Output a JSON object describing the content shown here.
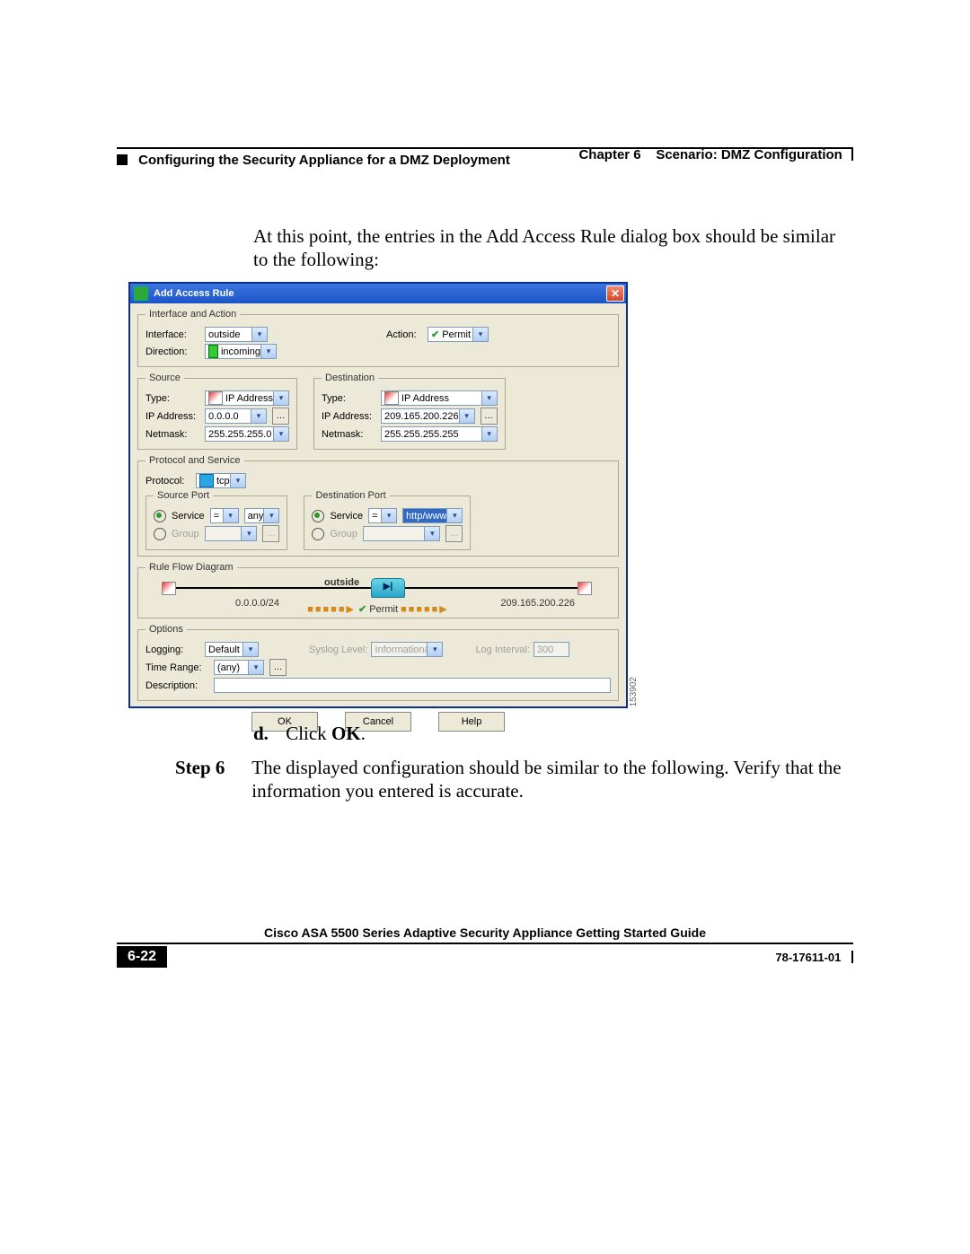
{
  "header": {
    "chapter": "Chapter 6",
    "scenario": "Scenario: DMZ Configuration",
    "section": "Configuring the Security Appliance for a DMZ Deployment"
  },
  "intro": "At this point, the entries in the Add Access Rule dialog box should be similar to the following:",
  "dialog": {
    "title": "Add Access Rule",
    "groups": {
      "iface": {
        "legend": "Interface and Action",
        "interface_label": "Interface:",
        "interface_value": "outside",
        "direction_label": "Direction:",
        "direction_value": "incoming",
        "action_label": "Action:",
        "action_value": "Permit"
      },
      "source": {
        "legend": "Source",
        "type_label": "Type:",
        "type_value": "IP Address",
        "ip_label": "IP Address:",
        "ip_value": "0.0.0.0",
        "mask_label": "Netmask:",
        "mask_value": "255.255.255.0"
      },
      "dest": {
        "legend": "Destination",
        "type_label": "Type:",
        "type_value": "IP Address",
        "ip_label": "IP Address:",
        "ip_value": "209.165.200.226",
        "mask_label": "Netmask:",
        "mask_value": "255.255.255.255"
      },
      "proto": {
        "legend": "Protocol and Service",
        "protocol_label": "Protocol:",
        "protocol_value": "tcp",
        "srcport_legend": "Source Port",
        "dstport_legend": "Destination Port",
        "service_label": "Service",
        "group_label": "Group",
        "src_op": "=",
        "src_val": "any",
        "dst_op": "=",
        "dst_val": "http/www"
      },
      "flow": {
        "legend": "Rule Flow Diagram",
        "ifname": "outside",
        "left_caption": "0.0.0.0/24",
        "right_caption": "209.165.200.226",
        "permit": "Permit"
      },
      "options": {
        "legend": "Options",
        "logging_label": "Logging:",
        "logging_value": "Default",
        "syslog_label": "Syslog Level:",
        "syslog_value": "Informational",
        "interval_label": "Log Interval:",
        "interval_value": "300",
        "timerange_label": "Time Range:",
        "timerange_value": "(any)",
        "description_label": "Description:"
      }
    },
    "buttons": {
      "ok": "OK",
      "cancel": "Cancel",
      "help": "Help"
    },
    "figure_number": "153902"
  },
  "substep": {
    "letter": "d.",
    "text_prefix": "Click ",
    "bold": "OK",
    "suffix": "."
  },
  "step6": {
    "label": "Step 6",
    "text": "The displayed configuration should be similar to the following. Verify that the information you entered is accurate."
  },
  "footer": {
    "book": "Cisco ASA 5500 Series Adaptive Security Appliance Getting Started Guide",
    "page": "6-22",
    "docnum": "78-17611-01"
  }
}
